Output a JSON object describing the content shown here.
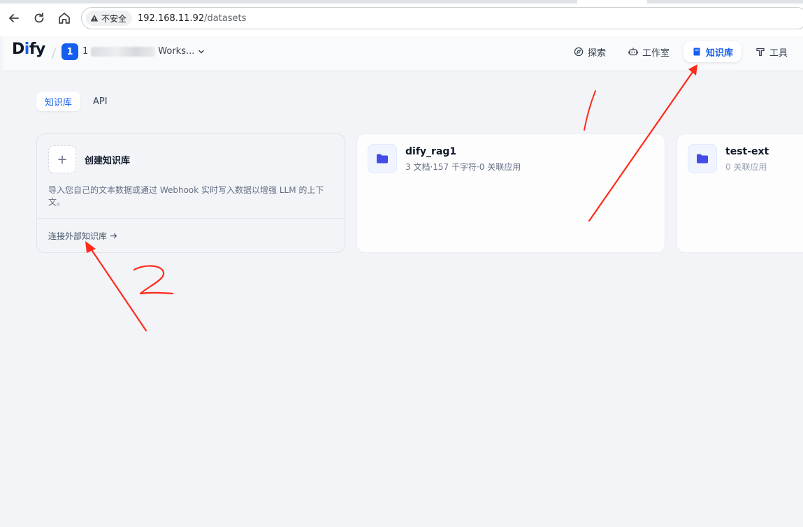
{
  "browser": {
    "security_label": "不安全",
    "url_host": "192.168.11.92",
    "url_path": "/datasets"
  },
  "header": {
    "logo_text_d": "D",
    "logo_text_i": "i",
    "logo_text_fy": "fy",
    "workspace_badge": "1",
    "workspace_name_prefix": "1",
    "workspace_name_suffix": "Works...",
    "nav": [
      {
        "label": "探索",
        "icon": "compass-icon",
        "active": false
      },
      {
        "label": "工作室",
        "icon": "robot-icon",
        "active": false
      },
      {
        "label": "知识库",
        "icon": "book-icon",
        "active": true
      },
      {
        "label": "工具",
        "icon": "hammer-icon",
        "active": false
      }
    ]
  },
  "sub_tabs": [
    {
      "label": "知识库",
      "active": true
    },
    {
      "label": "API",
      "active": false
    }
  ],
  "create_card": {
    "plus": "+",
    "title": "创建知识库",
    "description": "导入您自己的文本数据或通过 Webhook 实时写入数据以增强 LLM 的上下文。",
    "connect_label": "连接外部知识库"
  },
  "datasets": [
    {
      "name": "dify_rag1",
      "meta": "3 文档·157 千字符·0 关联应用"
    },
    {
      "name": "test-ext",
      "meta": "0 关联应用"
    }
  ],
  "colors": {
    "accent": "#155eef",
    "annotation": "#ff2a1a"
  }
}
